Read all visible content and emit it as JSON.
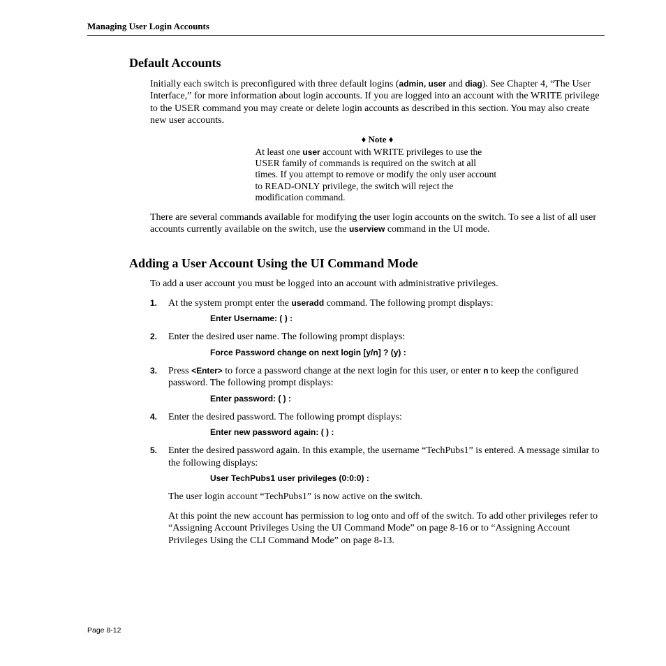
{
  "header": {
    "running_head": "Managing User Login Accounts"
  },
  "section1": {
    "title": "Default Accounts",
    "p1a": "Initially each switch is preconfigured with three default logins (",
    "p1b": "admin, user",
    "p1c": " and ",
    "p1d": "diag",
    "p1e": "). See Chapter 4, “The User Interface,” for more information about login accounts. If you are logged into an account with the ",
    "p1f": "WRITE",
    "p1g": " privilege to the ",
    "p1h": "USER",
    "p1i": " command you may create or delete login accounts as described in this section. You may also create new user accounts.",
    "note_title": "♦ Note ♦",
    "note_a": "At least one ",
    "note_b": "user",
    "note_c": " account with ",
    "note_d": "WRITE",
    "note_e": " privileges to use the ",
    "note_f": "USER",
    "note_g": " family of commands is required on the switch at all times. If you attempt to remove or modify the only user account to ",
    "note_h": "READ-ONLY",
    "note_i": " privilege, the switch will reject the modification command.",
    "p2a": "There are several commands available for modifying the user login accounts on the switch. To see a list of all user accounts currently available on the switch, use the ",
    "p2b": "userview",
    "p2c": " command in the UI mode."
  },
  "section2": {
    "title": "Adding a User Account Using the UI Command Mode",
    "intro": "To add a user account you must be logged into an account with administrative privileges.",
    "s1_num": "1.",
    "s1a": "At the system prompt enter the ",
    "s1b": "useradd",
    "s1c": " command. The following prompt displays:",
    "s1_prompt": "Enter Username: ( ) :",
    "s2_num": "2.",
    "s2": "Enter the desired user name. The following prompt displays:",
    "s2_prompt": "Force Password change on next login [y/n] ? (y) :",
    "s3_num": "3.",
    "s3a": "Press ",
    "s3b": "<Enter>",
    "s3c": " to force a password change at the next login for this user, or enter ",
    "s3d": "n",
    "s3e": " to keep the configured password. The following prompt displays:",
    "s3_prompt": "Enter password: ( ) :",
    "s4_num": "4.",
    "s4": "Enter the desired password. The following prompt displays:",
    "s4_prompt": "Enter new password again: ( ) :",
    "s5_num": "5.",
    "s5": "Enter the desired password again. In this example, the username “TechPubs1” is entered. A message similar to the following displays:",
    "s5_prompt": "User TechPubs1 user privileges (0:0:0) :",
    "closing1": "The user login account “TechPubs1” is now active on the switch.",
    "closing2": "At this point the new account has permission to log onto and off of the switch. To add other privileges refer to “Assigning Account Privileges Using the UI Command Mode” on page 8-16 or to “Assigning Account Privileges Using the CLI Command Mode” on page 8-13."
  },
  "footer": {
    "page": "Page 8-12"
  }
}
